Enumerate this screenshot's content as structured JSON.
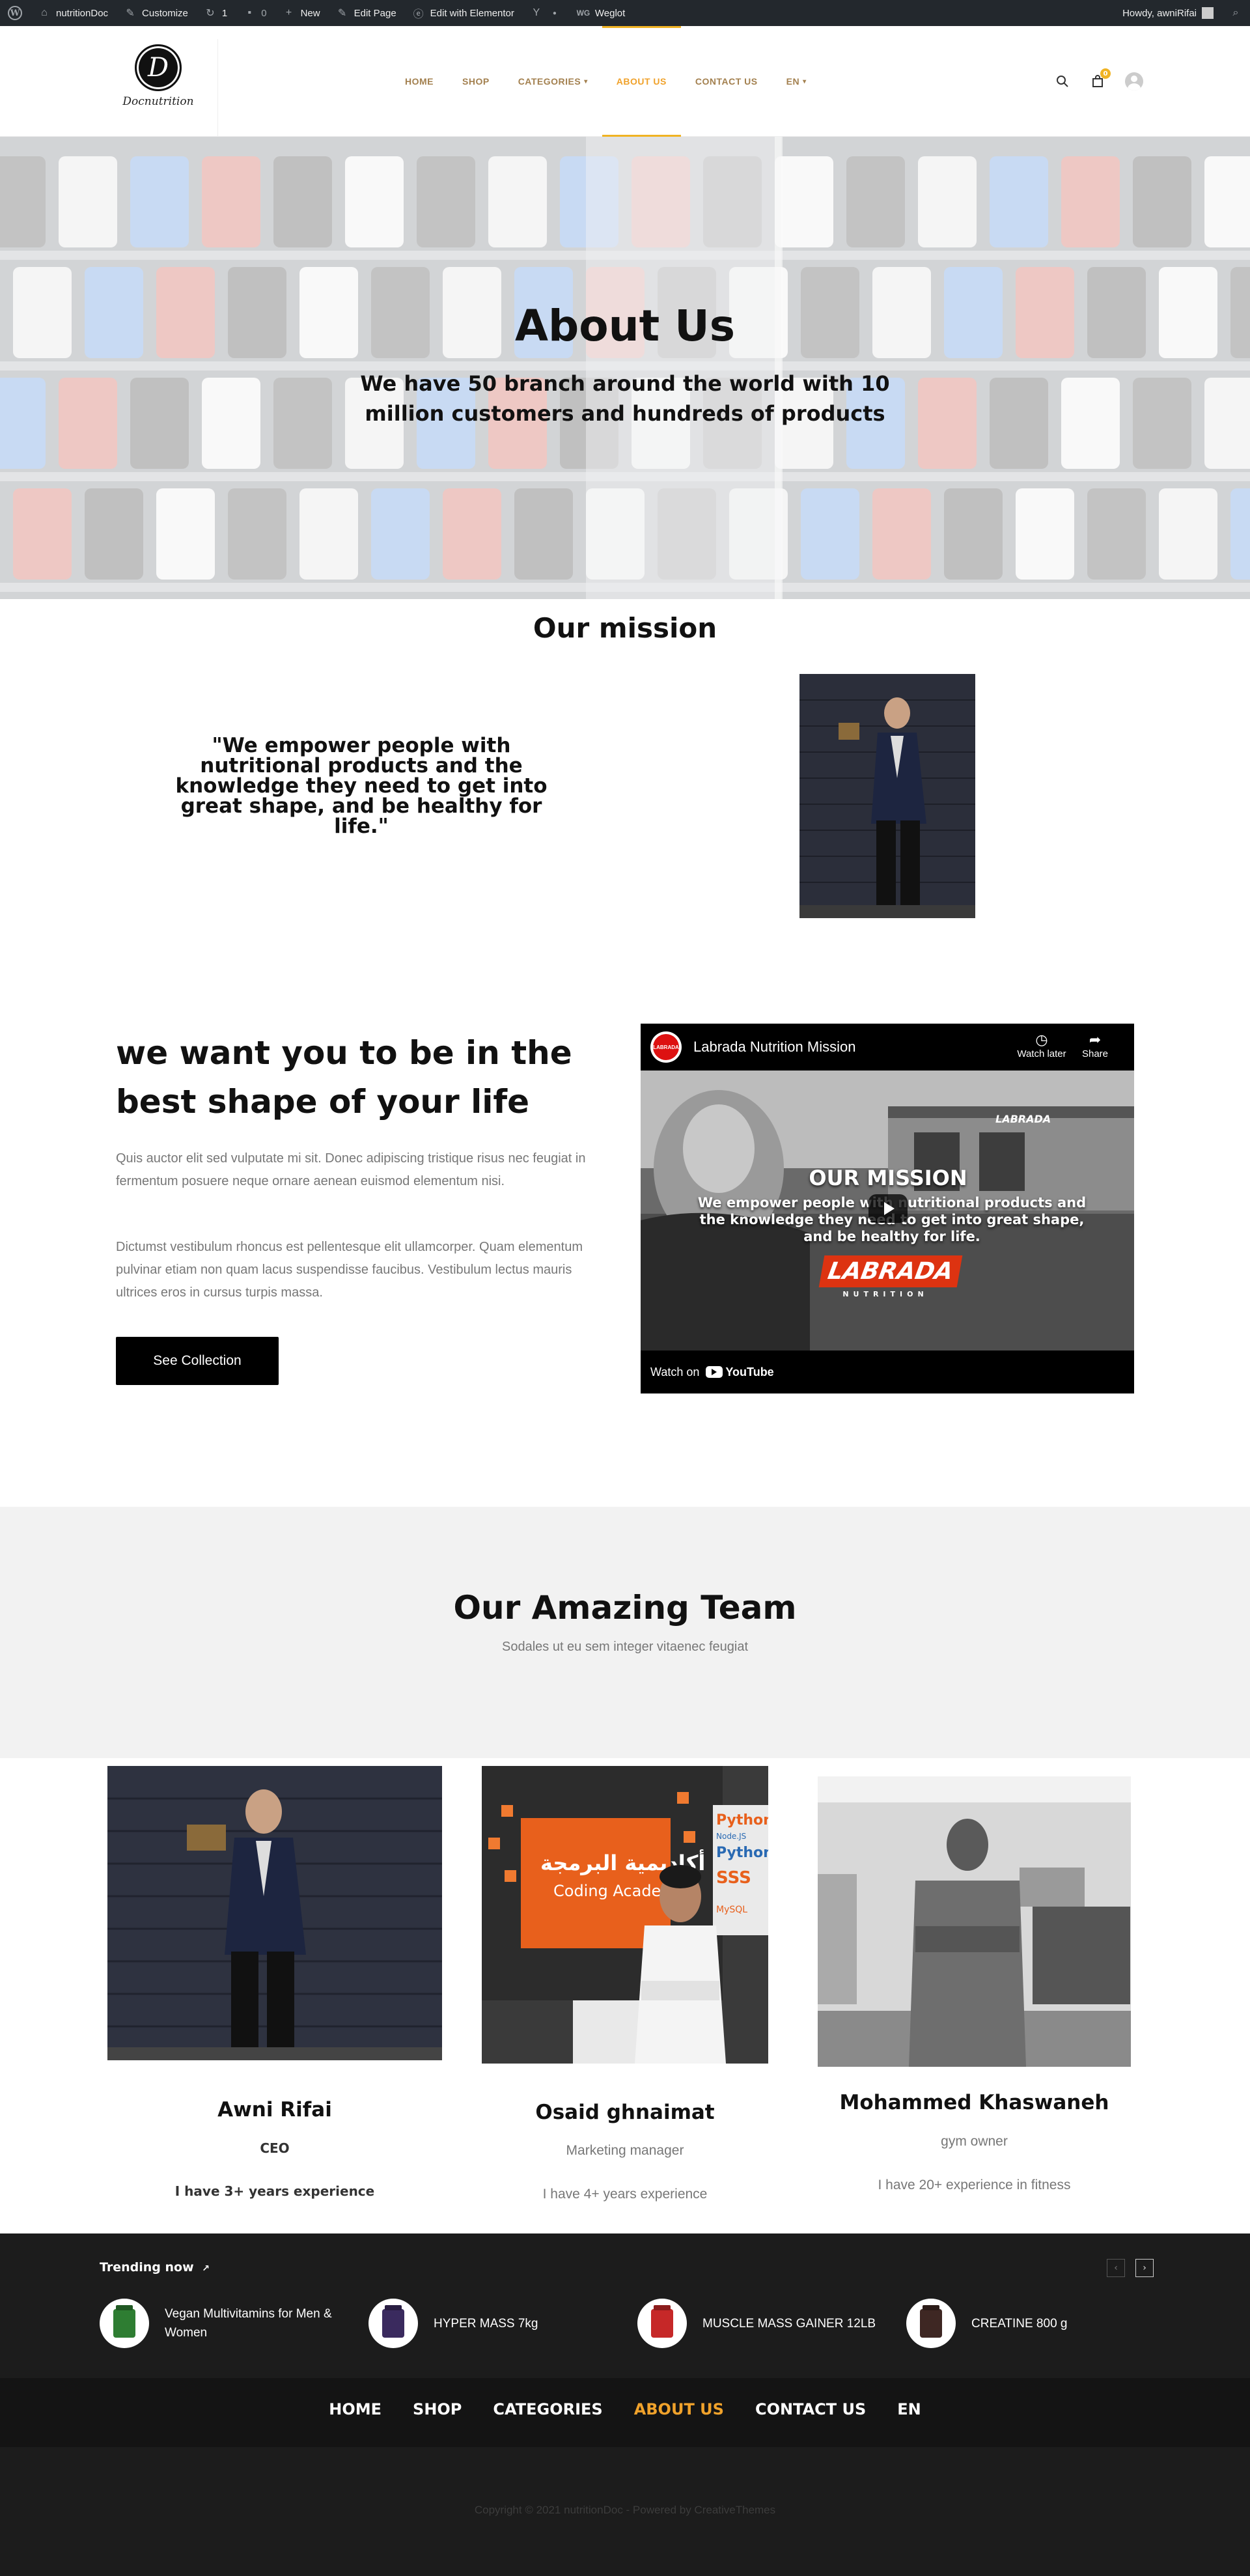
{
  "admin_bar": {
    "site_name": "nutritionDoc",
    "customize": "Customize",
    "updates_count": "1",
    "comments_count": "0",
    "new": "New",
    "edit_page": "Edit Page",
    "edit_elementor": "Edit with Elementor",
    "weglot": "Weglot",
    "howdy": "Howdy, awniRifai"
  },
  "header": {
    "logo_text": "Docnutrition",
    "nav": [
      {
        "label": "HOME",
        "active": false
      },
      {
        "label": "SHOP",
        "active": false
      },
      {
        "label": "CATEGORIES",
        "active": false,
        "dropdown": true
      },
      {
        "label": "ABOUT US",
        "active": true
      },
      {
        "label": "CONTACT US",
        "active": false
      },
      {
        "label": "EN",
        "active": false,
        "dropdown": true
      }
    ],
    "cart_count": "0",
    "accent_color": "#f0b323"
  },
  "hero": {
    "title": "About Us",
    "subtitle": "We have 50 branch around the world with 10 million customers and hundreds of products"
  },
  "mission": {
    "title": "Our mission",
    "quote": "\"We empower people with nutritional products and the knowledge they need to get into great shape, and be healthy for life.\""
  },
  "shape": {
    "title": "we want you to be in the best shape of your life",
    "paragraph1": "Quis auctor elit sed vulputate mi sit. Donec adipiscing tristique risus nec feugiat in fermentum posuere neque ornare aenean euismod elementum nisi.",
    "paragraph2": "Dictumst vestibulum rhoncus est pellentesque elit ullamcorper. Quam elementum pulvinar etiam non quam lacus suspendisse faucibus. Vestibulum lectus mauris ultrices eros in cursus turpis massa.",
    "button": "See Collection"
  },
  "video": {
    "channel_badge": "LABRADA",
    "title": "Labrada Nutrition Mission",
    "watch_later": "Watch later",
    "share": "Share",
    "headline": "OUR MISSION",
    "body": "We empower people with nutritional products and the knowledge they need to get into great shape, and be healthy for life.",
    "brand": "LABRADA",
    "brand_sub": "NUTRITION",
    "building_sign": "LABRADA",
    "watch_on": "Watch on",
    "youtube": "YouTube"
  },
  "team": {
    "title": "Our Amazing Team",
    "subtitle": "Sodales ut eu sem integer vitaenec feugiat",
    "members": [
      {
        "name": "Awni Rifai",
        "role": "CEO",
        "experience": "I have 3+ years experience"
      },
      {
        "name": "Osaid ghnaimat",
        "role": "Marketing manager",
        "experience": "I have 4+ years experience"
      },
      {
        "name": "Mohammed Khaswaneh",
        "role": "gym owner",
        "experience": "I have 20+ experience in fitness"
      }
    ],
    "coding_sign_ar": "أكاديمية البرمجة",
    "coding_sign_en": "Coding Academy",
    "coding_tags": [
      "Python",
      "Node.JS",
      "Python",
      "SSS",
      "MySQL"
    ]
  },
  "trending": {
    "label": "Trending now",
    "items": [
      {
        "name": "Vegan Multivitamins for Men & Women",
        "color": "#2e7d32"
      },
      {
        "name": "HYPER MASS 7kg",
        "color": "#3a2a5e"
      },
      {
        "name": "MUSCLE MASS GAINER 12LB",
        "color": "#c62828"
      },
      {
        "name": "CREATINE 800 g",
        "color": "#3e2723"
      }
    ]
  },
  "footer": {
    "nav": [
      {
        "label": "HOME",
        "active": false
      },
      {
        "label": "SHOP",
        "active": false
      },
      {
        "label": "CATEGORIES",
        "active": false
      },
      {
        "label": "ABOUT US",
        "active": true
      },
      {
        "label": "CONTACT US",
        "active": false
      },
      {
        "label": "EN",
        "active": false
      }
    ],
    "copyright": "Copyright © 2021 nutritionDoc - Powered by CreativeThemes"
  }
}
